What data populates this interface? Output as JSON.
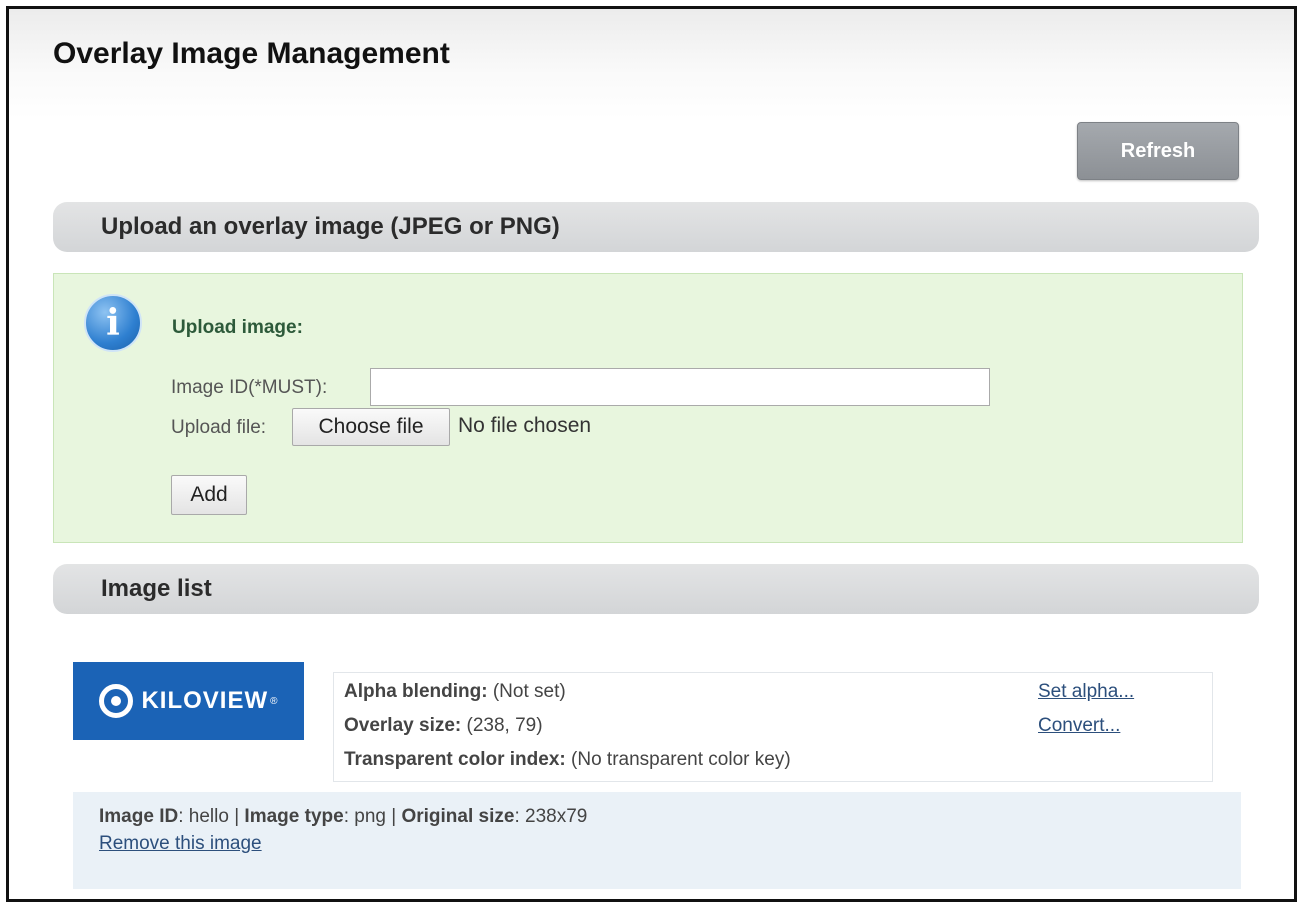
{
  "page": {
    "title": "Overlay Image Management",
    "refresh_label": "Refresh"
  },
  "upload": {
    "section_title": "Upload an overlay image (JPEG or PNG)",
    "heading": "Upload image:",
    "image_id_label": "Image ID(*MUST):",
    "image_id_value": "",
    "upload_file_label": "Upload file:",
    "choose_file_label": "Choose file",
    "no_file_text": "No file chosen",
    "add_label": "Add"
  },
  "image_list": {
    "section_title": "Image list",
    "items": [
      {
        "thumbnail_text": "KILOVIEW",
        "thumbnail_mark": "®",
        "alpha_label": "Alpha blending:",
        "alpha_value": "(Not set)",
        "size_label": "Overlay size:",
        "size_value": "(238, 79)",
        "transparent_label": "Transparent color index:",
        "transparent_value": "(No transparent color key)",
        "set_alpha_link": "Set alpha...",
        "convert_link": "Convert...",
        "image_id_label": "Image ID",
        "image_id": "hello",
        "image_type_label": "Image type",
        "image_type": "png",
        "original_size_label": "Original size",
        "original_size": "238x79",
        "remove_link": "Remove this image"
      }
    ]
  },
  "colors": {
    "upload_panel_bg": "#e8f6de",
    "section_bar_bg": "#d8dadc",
    "refresh_button_bg": "#9a9ea3",
    "thumbnail_bg": "#1b63b6",
    "meta_panel_bg": "#eaf1f7",
    "link": "#2c4f7c"
  },
  "icons": {
    "info": "info-circle-icon",
    "thumbnail_logo": "kiloview-logo-icon"
  }
}
